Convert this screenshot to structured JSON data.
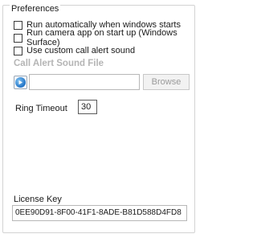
{
  "group": {
    "title": "Preferences"
  },
  "checkboxes": [
    {
      "label": "Run automatically when windows starts",
      "checked": false
    },
    {
      "label": "Run camera app on start up (Windows Surface)",
      "checked": false
    },
    {
      "label": "Use custom call alert sound",
      "checked": false
    }
  ],
  "call_alert": {
    "title": "Call Alert Sound File",
    "file_value": "",
    "browse_label": "Browse",
    "play_icon": "play-icon"
  },
  "ring_timeout": {
    "label": "Ring Timeout",
    "value": "30"
  },
  "license": {
    "label": "License Key",
    "value": "0EE90D91-8F00-41F1-8ADE-B81D588D4FD8"
  },
  "colors": {
    "section_title": "#b5b5b5",
    "border": "#d3d3d3",
    "play_accent": "#1c6fc4"
  }
}
